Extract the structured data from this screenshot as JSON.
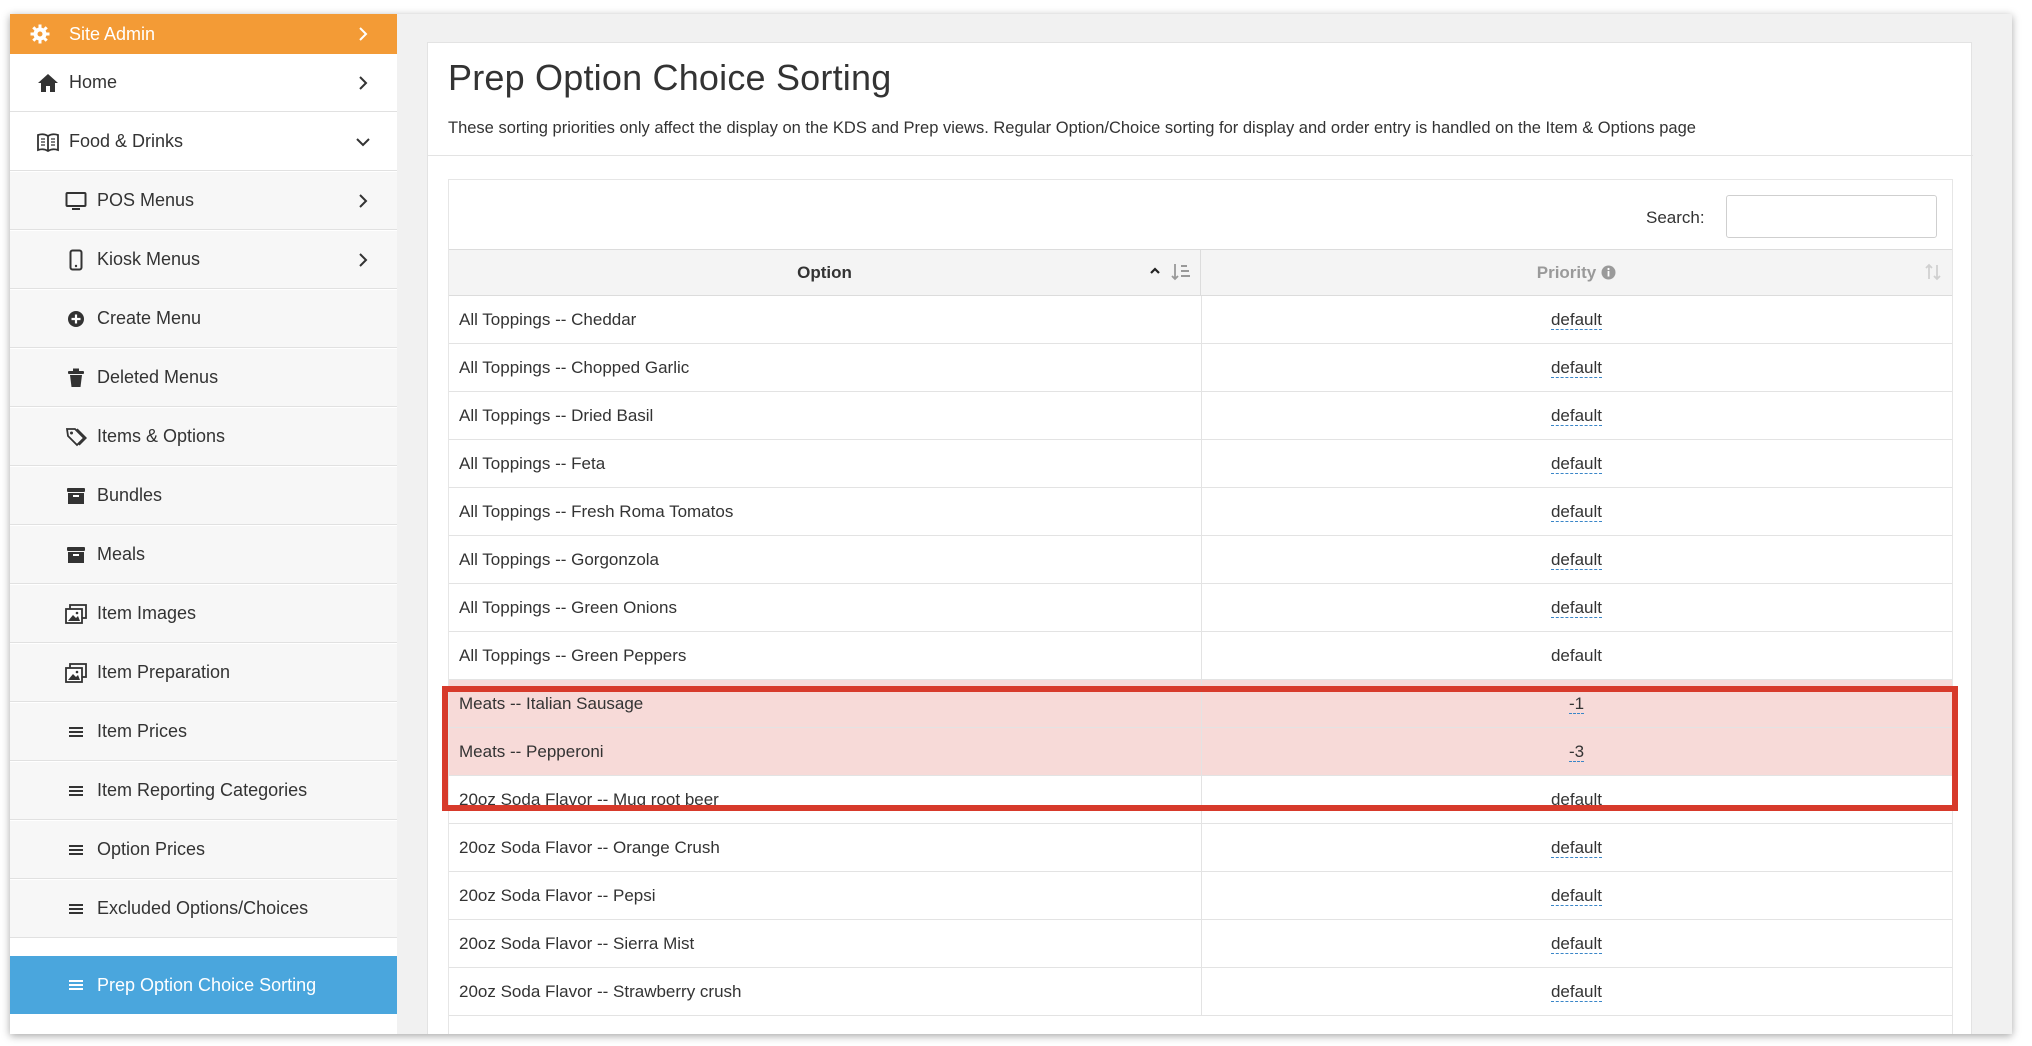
{
  "sidebar": {
    "items": [
      {
        "label": "Site Admin",
        "icon": "gear-icon",
        "chevron": "right"
      },
      {
        "label": "Home",
        "icon": "home-icon",
        "chevron": "right"
      },
      {
        "label": "Food & Drinks",
        "icon": "menu-book-icon",
        "chevron": "down"
      },
      {
        "label": "POS Menus",
        "icon": "monitor-icon",
        "chevron": "right"
      },
      {
        "label": "Kiosk Menus",
        "icon": "tablet-icon",
        "chevron": "right"
      },
      {
        "label": "Create Menu",
        "icon": "plus-circle-icon"
      },
      {
        "label": "Deleted Menus",
        "icon": "trash-icon"
      },
      {
        "label": "Items & Options",
        "icon": "tags-icon"
      },
      {
        "label": "Bundles",
        "icon": "archive-icon"
      },
      {
        "label": "Meals",
        "icon": "archive-icon"
      },
      {
        "label": "Item Images",
        "icon": "images-icon"
      },
      {
        "label": "Item Preparation",
        "icon": "images-icon"
      },
      {
        "label": "Item Prices",
        "icon": "list-icon"
      },
      {
        "label": "Item Reporting Categories",
        "icon": "list-icon"
      },
      {
        "label": "Option Prices",
        "icon": "list-icon"
      },
      {
        "label": "Excluded Options/Choices",
        "icon": "list-icon"
      },
      {
        "label": "Prep Option Choice Sorting",
        "icon": "list-icon"
      }
    ]
  },
  "page": {
    "title": "Prep Option Choice Sorting",
    "subtitle": "These sorting priorities only affect the display on the KDS and Prep views. Regular Option/Choice sorting for display and order entry is handled on the Item & Options page"
  },
  "search": {
    "label": "Search:",
    "value": ""
  },
  "table": {
    "headers": {
      "option": "Option",
      "priority": "Priority"
    },
    "rows": [
      {
        "option": "All Toppings -- Cheddar",
        "priority": "default"
      },
      {
        "option": "All Toppings -- Chopped Garlic",
        "priority": "default"
      },
      {
        "option": "All Toppings -- Dried Basil",
        "priority": "default"
      },
      {
        "option": "All Toppings -- Feta",
        "priority": "default"
      },
      {
        "option": "All Toppings -- Fresh Roma Tomatos",
        "priority": "default"
      },
      {
        "option": "All Toppings -- Gorgonzola",
        "priority": "default"
      },
      {
        "option": "All Toppings -- Green Onions",
        "priority": "default"
      },
      {
        "option": "All Toppings -- Green Peppers",
        "priority": "default"
      },
      {
        "option": "Meats -- Italian Sausage",
        "priority": "-1"
      },
      {
        "option": "Meats -- Pepperoni",
        "priority": "-3"
      },
      {
        "option": "20oz Soda Flavor -- Mug root beer",
        "priority": "default"
      },
      {
        "option": "20oz Soda Flavor -- Orange Crush",
        "priority": "default"
      },
      {
        "option": "20oz Soda Flavor -- Pepsi",
        "priority": "default"
      },
      {
        "option": "20oz Soda Flavor -- Sierra Mist",
        "priority": "default"
      },
      {
        "option": "20oz Soda Flavor -- Strawberry crush",
        "priority": "default"
      }
    ]
  },
  "colors": {
    "admin": "#f39b36",
    "active": "#4aa6dd",
    "highlight_border": "#d73a2b",
    "highlight_fill": "#f7dad8",
    "link_dashed": "#3a86c8"
  }
}
